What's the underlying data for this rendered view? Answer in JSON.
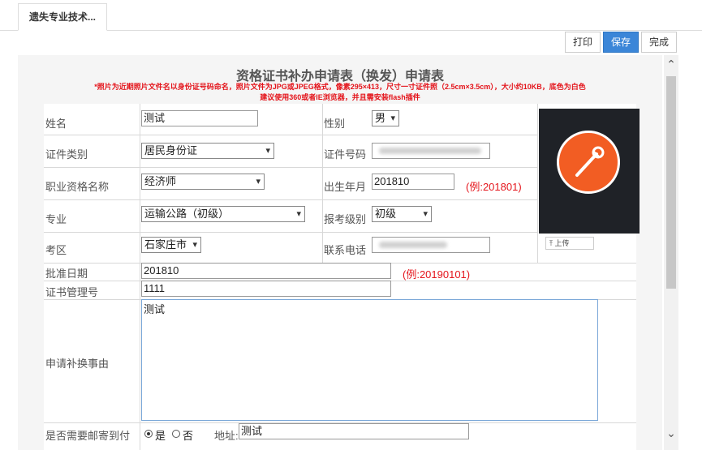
{
  "tab": {
    "label": "遗失专业技术..."
  },
  "toolbar": {
    "print": "打印",
    "save": "保存",
    "done": "完成"
  },
  "form": {
    "title": "资格证书补办申请表（换发）申请表",
    "note1": "*照片为近期照片文件名以身份证号码命名，照片文件为JPG或JPEG格式，像素295×413，尺寸一寸证件照（2.5cm×3.5cm），大小约10KB，底色为白色",
    "note2": "建议使用360或者IE浏览器，并且需安装flash插件",
    "name_label": "姓名",
    "name_value": "测试",
    "gender_label": "性别",
    "gender_value": "男",
    "idtype_label": "证件类别",
    "idtype_value": "居民身份证",
    "idno_label": "证件号码",
    "idno_value": "",
    "qual_label": "职业资格名称",
    "qual_value": "经济师",
    "birth_label": "出生年月",
    "birth_value": "201810",
    "birth_example": "(例:201801)",
    "major_label": "专业",
    "major_value": "运输公路（初级）",
    "level_label": "报考级别",
    "level_value": "初级",
    "area_label": "考区",
    "area_value": "石家庄市",
    "phone_label": "联系电话",
    "phone_value": "",
    "upload_label": "上传",
    "approve_label": "批准日期",
    "approve_value": "201810",
    "approve_example": "(例:20190101)",
    "certno_label": "证书管理号",
    "certno_value": "1111",
    "reason_label": "申请补换事由",
    "reason_value": "测试",
    "mail_label": "是否需要邮寄到付",
    "mail_yes": "是",
    "mail_no": "否",
    "address_label": "地址:",
    "address_value": "测试"
  },
  "colors": {
    "accent": "#3b86d8",
    "warning": "#e4141b",
    "photo_logo": "#f25d23"
  }
}
